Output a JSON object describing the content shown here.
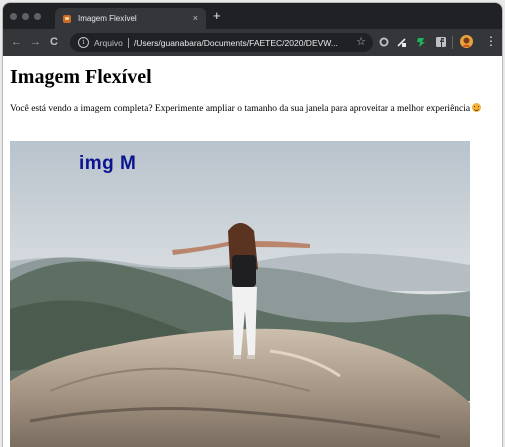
{
  "browser": {
    "tab_title": "Imagem Flexível",
    "tab_close": "×",
    "new_tab": "+",
    "nav_back": "←",
    "nav_forward": "→",
    "nav_reload": "C",
    "url_scheme": "Arquivo",
    "url_path": "/Users/guanabara/Documents/FAETEC/2020/DEVW...",
    "bookmark_star": "☆",
    "menu": "⋮"
  },
  "page": {
    "heading": "Imagem Flexível",
    "paragraph": "Você está vendo a imagem completa? Experimente ampliar o tamanho da sua janela para aproveitar a melhor experiência",
    "image_overlay_text": "img M"
  },
  "colors": {
    "tab_bar": "#202124",
    "toolbar": "#35363a",
    "overlay_text": "#0b148f"
  }
}
